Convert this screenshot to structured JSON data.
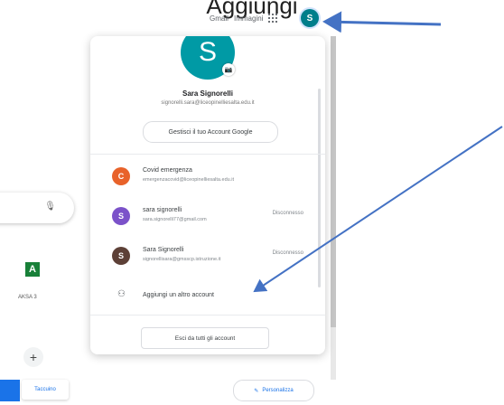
{
  "page_header_partial": "Aggiungi",
  "topbar": {
    "gmail_label": "Gmail",
    "images_label": "Immagini",
    "apps_icon": "apps-grid-icon",
    "avatar_initial": "S"
  },
  "account_panel": {
    "avatar_initial": "S",
    "camera_icon": "camera-icon",
    "name": "Sara Signorelli",
    "email": "signorelli.sara@liceopinelliesalta.edu.it",
    "manage_button": "Gestisci il tuo Account Google",
    "accounts": [
      {
        "initial": "C",
        "color": "#e8622a",
        "name": "Covid emergenza",
        "email": "emergenzacovid@liceopinelliesalta.edu.it",
        "status": ""
      },
      {
        "initial": "S",
        "color": "#7b52c9",
        "name": "sara signorelli",
        "email": "sara.signorelli77@gmail.com",
        "status": "Disconnesso"
      },
      {
        "initial": "S",
        "color": "#5d4037",
        "name": "Sara Signorelli",
        "email": "signorellisara@gmsscp.istruzione.it",
        "status": "Disconnesso"
      }
    ],
    "add_account": "Aggiungi un altro account",
    "add_account_icon": "person-add-icon",
    "sign_out_all": "Esci da tutti gli account"
  },
  "left_page": {
    "app_tile_letter": "A",
    "app_tile_label": "AKSA 3",
    "plus_symbol": "+",
    "search_mic_icon": "microphone-icon",
    "bottom_button": "Taccuino",
    "personalize_button": "Personalizza"
  },
  "annotation_color": "#4472c4"
}
